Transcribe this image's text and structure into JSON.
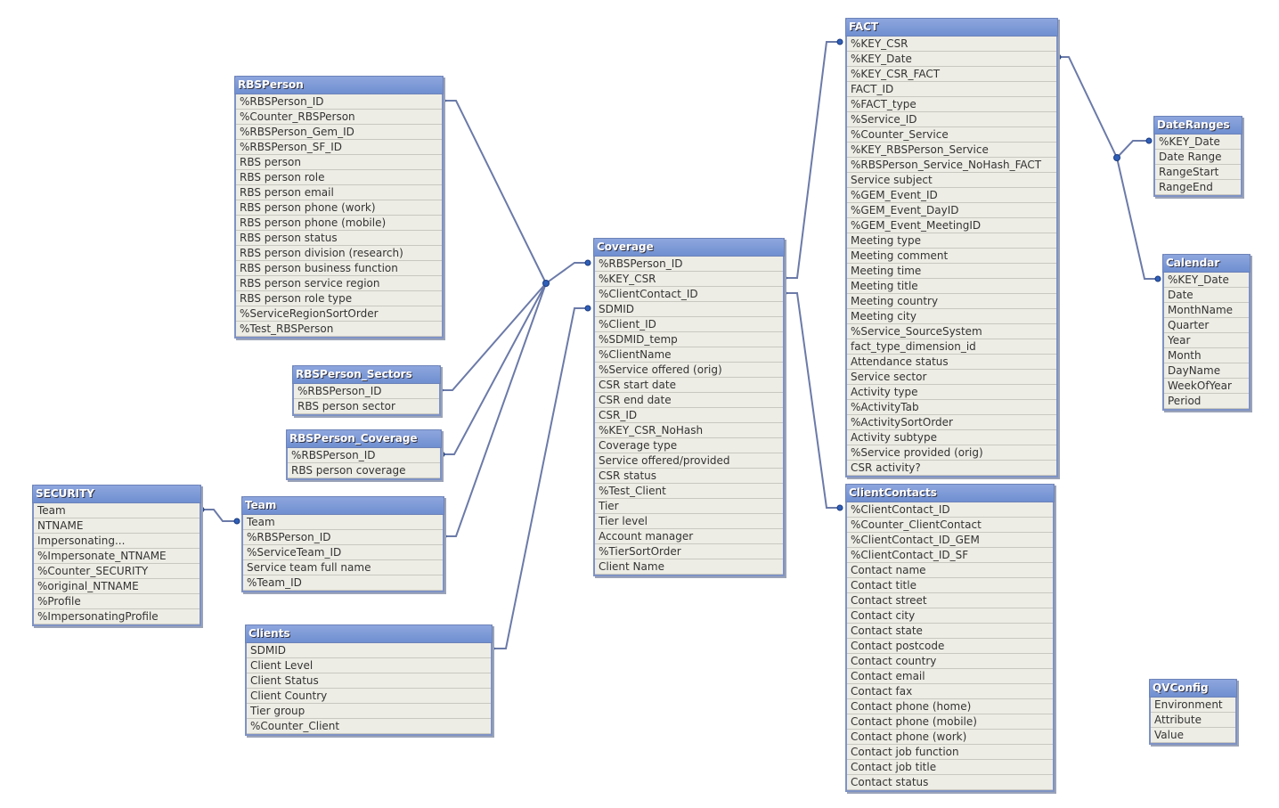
{
  "tables": [
    {
      "name": "RBSPerson",
      "fields": [
        "%RBSPerson_ID",
        "%Counter_RBSPerson",
        "%RBSPerson_Gem_ID",
        "%RBSPerson_SF_ID",
        "RBS person",
        "RBS person role",
        "RBS person email",
        "RBS person phone (work)",
        "RBS person phone (mobile)",
        "RBS person status",
        "RBS person division (research)",
        "RBS person business function",
        "RBS person service region",
        "RBS person role type",
        "%ServiceRegionSortOrder",
        "%Test_RBSPerson"
      ]
    },
    {
      "name": "RBSPerson_Sectors",
      "fields": [
        "%RBSPerson_ID",
        "RBS person sector"
      ]
    },
    {
      "name": "RBSPerson_Coverage",
      "fields": [
        "%RBSPerson_ID",
        "RBS person coverage"
      ]
    },
    {
      "name": "SECURITY",
      "fields": [
        "Team",
        "NTNAME",
        "Impersonating...",
        "%Impersonate_NTNAME",
        "%Counter_SECURITY",
        "%original_NTNAME",
        "%Profile",
        "%ImpersonatingProfile"
      ]
    },
    {
      "name": "Team",
      "fields": [
        "Team",
        "%RBSPerson_ID",
        "%ServiceTeam_ID",
        "Service team full name",
        "%Team_ID"
      ]
    },
    {
      "name": "Clients",
      "fields": [
        "SDMID",
        "Client Level",
        "Client Status",
        "Client Country",
        "Tier group",
        "%Counter_Client"
      ]
    },
    {
      "name": "Coverage",
      "fields": [
        "%RBSPerson_ID",
        "%KEY_CSR",
        "%ClientContact_ID",
        "SDMID",
        "%Client_ID",
        "%SDMID_temp",
        "%ClientName",
        "%Service offered (orig)",
        "CSR start date",
        "CSR end date",
        "CSR_ID",
        "%KEY_CSR_NoHash",
        "Coverage type",
        "Service offered/provided",
        "CSR status",
        "%Test_Client",
        "Tier",
        "Tier level",
        "Account manager",
        "%TierSortOrder",
        "Client Name"
      ]
    },
    {
      "name": "FACT",
      "fields": [
        "%KEY_CSR",
        "%KEY_Date",
        "%KEY_CSR_FACT",
        "FACT_ID",
        "%FACT_type",
        "%Service_ID",
        "%Counter_Service",
        "%KEY_RBSPerson_Service",
        "%RBSPerson_Service_NoHash_FACT",
        "Service subject",
        "%GEM_Event_ID",
        "%GEM_Event_DayID",
        "%GEM_Event_MeetingID",
        "Meeting type",
        "Meeting comment",
        "Meeting time",
        "Meeting title",
        "Meeting country",
        "Meeting city",
        "%Service_SourceSystem",
        "fact_type_dimension_id",
        "Attendance status",
        "Service sector",
        "Activity type",
        "%ActivityTab",
        "%ActivitySortOrder",
        "Activity subtype",
        "%Service provided (orig)",
        "CSR activity?"
      ]
    },
    {
      "name": "ClientContacts",
      "fields": [
        "%ClientContact_ID",
        "%Counter_ClientContact",
        "%ClientContact_ID_GEM",
        "%ClientContact_ID_SF",
        "Contact name",
        "Contact title",
        "Contact street",
        "Contact city",
        "Contact state",
        "Contact postcode",
        "Contact country",
        "Contact email",
        "Contact fax",
        "Contact phone (home)",
        "Contact phone (mobile)",
        "Contact phone (work)",
        "Contact job function",
        "Contact job title",
        "Contact status"
      ]
    },
    {
      "name": "DateRanges",
      "fields": [
        "%KEY_Date",
        "Date Range",
        "RangeStart",
        "RangeEnd"
      ]
    },
    {
      "name": "Calendar",
      "fields": [
        "%KEY_Date",
        "Date",
        "MonthName",
        "Quarter",
        "Year",
        "Month",
        "DayName",
        "WeekOfYear",
        "Period"
      ]
    },
    {
      "name": "QVConfig",
      "fields": [
        "Environment",
        "Attribute",
        "Value"
      ]
    }
  ],
  "colors": {
    "header": "#7f9ad8",
    "link": "#6b7aa8",
    "body": "#eeede5"
  }
}
